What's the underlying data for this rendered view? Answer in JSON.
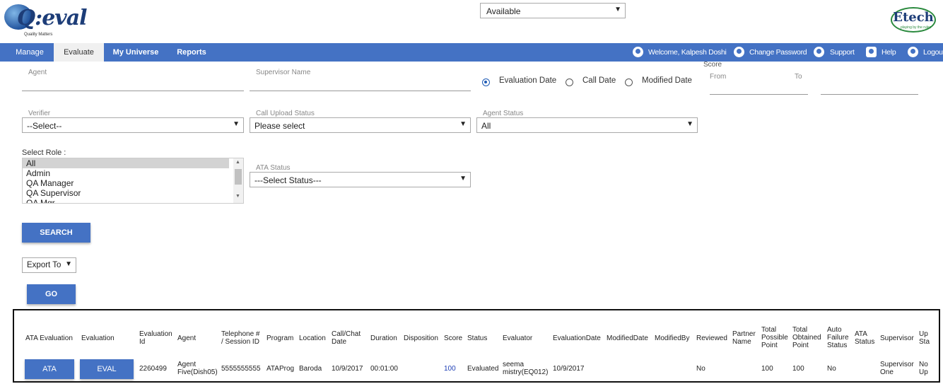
{
  "brand": {
    "logo_text": "Q:eval",
    "tagline": "Quality Matters",
    "right_logo": "Etech",
    "right_tag": "playing by the rules"
  },
  "availability": {
    "value": "Available"
  },
  "nav": {
    "items": [
      {
        "label": "Manage"
      },
      {
        "label": "Evaluate"
      },
      {
        "label": "My Universe"
      },
      {
        "label": "Reports"
      }
    ],
    "welcome": "Welcome, Kalpesh Doshi",
    "change_password": "Change Password",
    "support": "Support",
    "help": "Help",
    "logout": "Logout"
  },
  "icons": {
    "user": "user-icon",
    "gear": "gear-icon",
    "support": "support-icon",
    "help": "help-icon",
    "power": "power-icon",
    "dropdown": "chevron-down-icon"
  },
  "form": {
    "agent_label": "Agent",
    "supervisor_label": "Supervisor Name",
    "radios": [
      {
        "label": "Evaluation Date",
        "checked": true
      },
      {
        "label": "Call Date",
        "checked": false
      },
      {
        "label": "Modified Date",
        "checked": false
      }
    ],
    "score_label": "Score",
    "from_label": "From",
    "to_label": "To",
    "verifier_label": "Verifier",
    "verifier_value": "--Select--",
    "upload_label": "Call Upload Status",
    "upload_value": "Please select",
    "agent_status_label": "Agent Status",
    "agent_status_value": "All",
    "role_label": "Select Role :",
    "roles": [
      "All",
      "Admin",
      "QA Manager",
      "QA Supervisor",
      "QA Mgr"
    ],
    "ata_status_label": "ATA Status",
    "ata_status_value": "---Select Status---",
    "search_button": "SEARCH",
    "export_value": "Export To",
    "go_button": "GO"
  },
  "table": {
    "headers": [
      "ATA Evaluation",
      "Evaluation",
      "Evaluation Id",
      "Agent",
      "Telephone # / Session ID",
      "Program",
      "Location",
      "Call/Chat Date",
      "Duration",
      "Disposition",
      "Score",
      "Status",
      "Evaluator",
      "EvaluationDate",
      "ModifiedDate",
      "ModifiedBy",
      "Reviewed",
      "Partner Name",
      "Total Possible Point",
      "Total Obtained Point",
      "Auto Failure Status",
      "ATA Status",
      "Supervisor",
      "Up Sta"
    ],
    "rows": [
      {
        "ata_button": "ATA",
        "eval_button": "EVAL",
        "eval_id": "2260499",
        "agent": "Agent Five(Dish05)",
        "telephone": "5555555555",
        "program": "ATAProg",
        "location": "Baroda",
        "call_date": "10/9/2017",
        "duration": "00:01:00",
        "disposition": "",
        "score": "100",
        "status": "Evaluated",
        "evaluator": "seema mistry(EQ012)",
        "evaluation_date": "10/9/2017",
        "modified_date": "",
        "modified_by": "",
        "reviewed": "No",
        "partner": "",
        "possible": "100",
        "obtained": "100",
        "auto_failure": "No",
        "ata_status": "",
        "supervisor": "Supervisor One",
        "upload_status": "No Up"
      }
    ]
  }
}
